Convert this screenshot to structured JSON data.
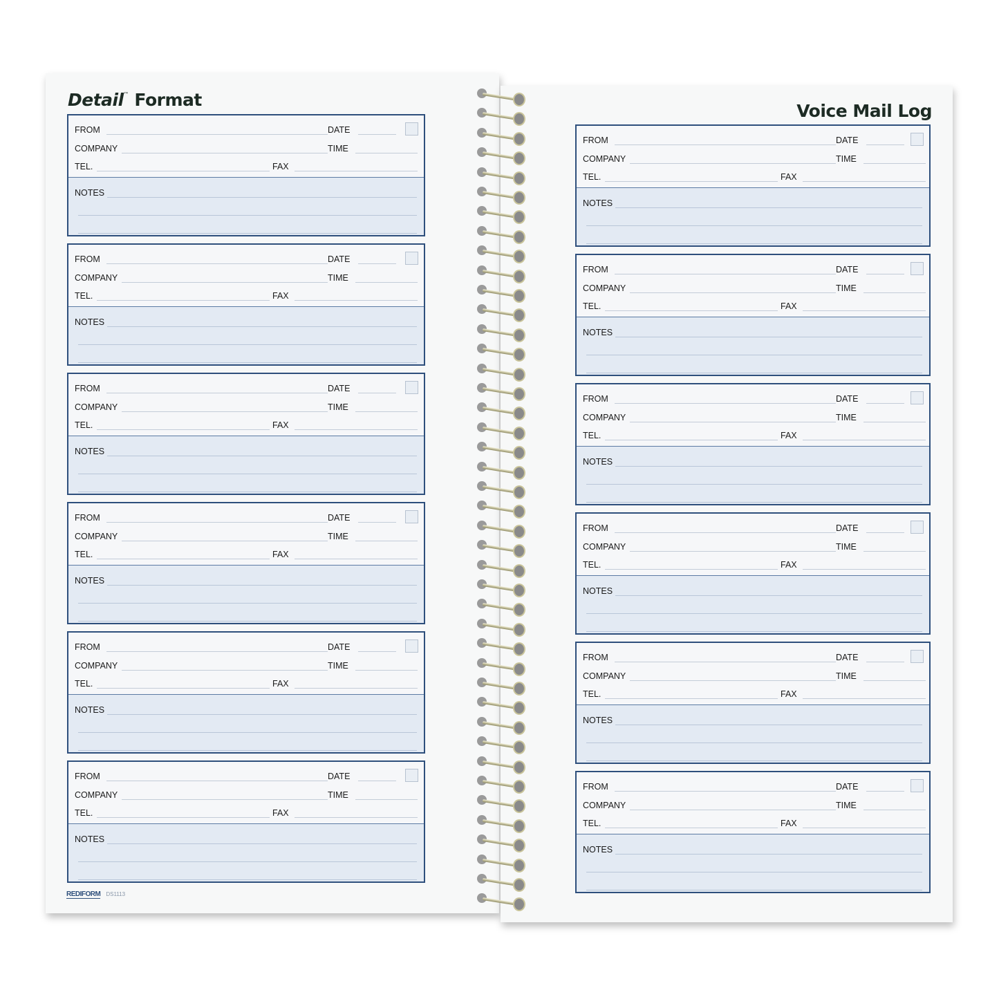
{
  "left_page": {
    "title_italic": "Detail",
    "title_tm": "™",
    "title_rest": "Format",
    "footer_brand": "REDIFORM",
    "footer_code": "DS1113"
  },
  "right_page": {
    "title": "Voice Mail Log"
  },
  "form_labels": {
    "from": "FROM",
    "date": "DATE",
    "company": "COMPANY",
    "time": "TIME",
    "tel": "TEL.",
    "fax": "FAX",
    "notes": "NOTES"
  },
  "messages_per_page": 6,
  "colors": {
    "border": "#2e4f7c",
    "notes_bg": "#e3eaf3",
    "title": "#1d2b24"
  }
}
